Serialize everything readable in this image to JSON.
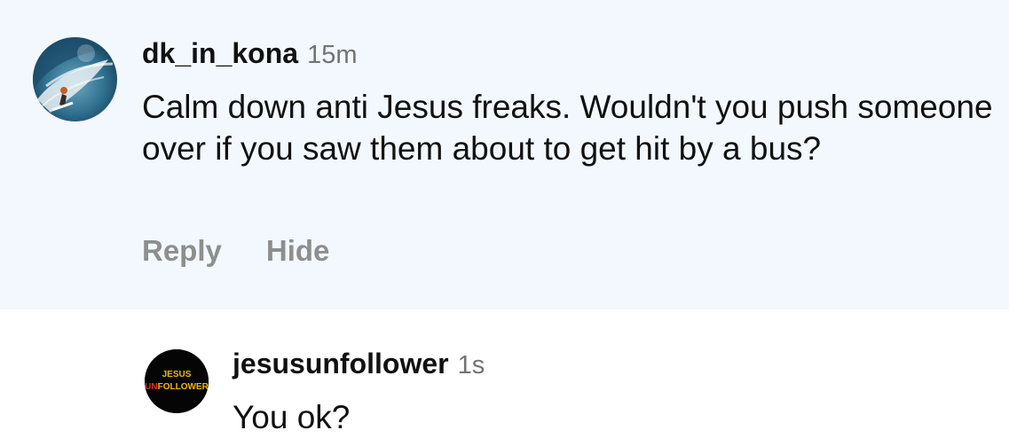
{
  "comment": {
    "username": "dk_in_kona",
    "timestamp": "15m",
    "text": "Calm down anti Jesus freaks. Wouldn't you push someone over if you saw them about to get hit by a bus?",
    "avatar_icon": "surfer-wave-photo",
    "actions": {
      "reply_label": "Reply",
      "hide_label": "Hide"
    },
    "background_color": "#f2f8fd"
  },
  "reply": {
    "username": "jesusunfollower",
    "timestamp": "1s",
    "text": "You ok?",
    "avatar": {
      "logo_line1": "JESUS",
      "logo_line2_prefix": "UN",
      "logo_line2_rest": "FOLLOWER",
      "accent_color": "#d8321f",
      "logo_color": "#f2b705"
    }
  },
  "colors": {
    "text": "#111111",
    "secondary_text": "#737373",
    "action_text": "#8e8e8e"
  }
}
